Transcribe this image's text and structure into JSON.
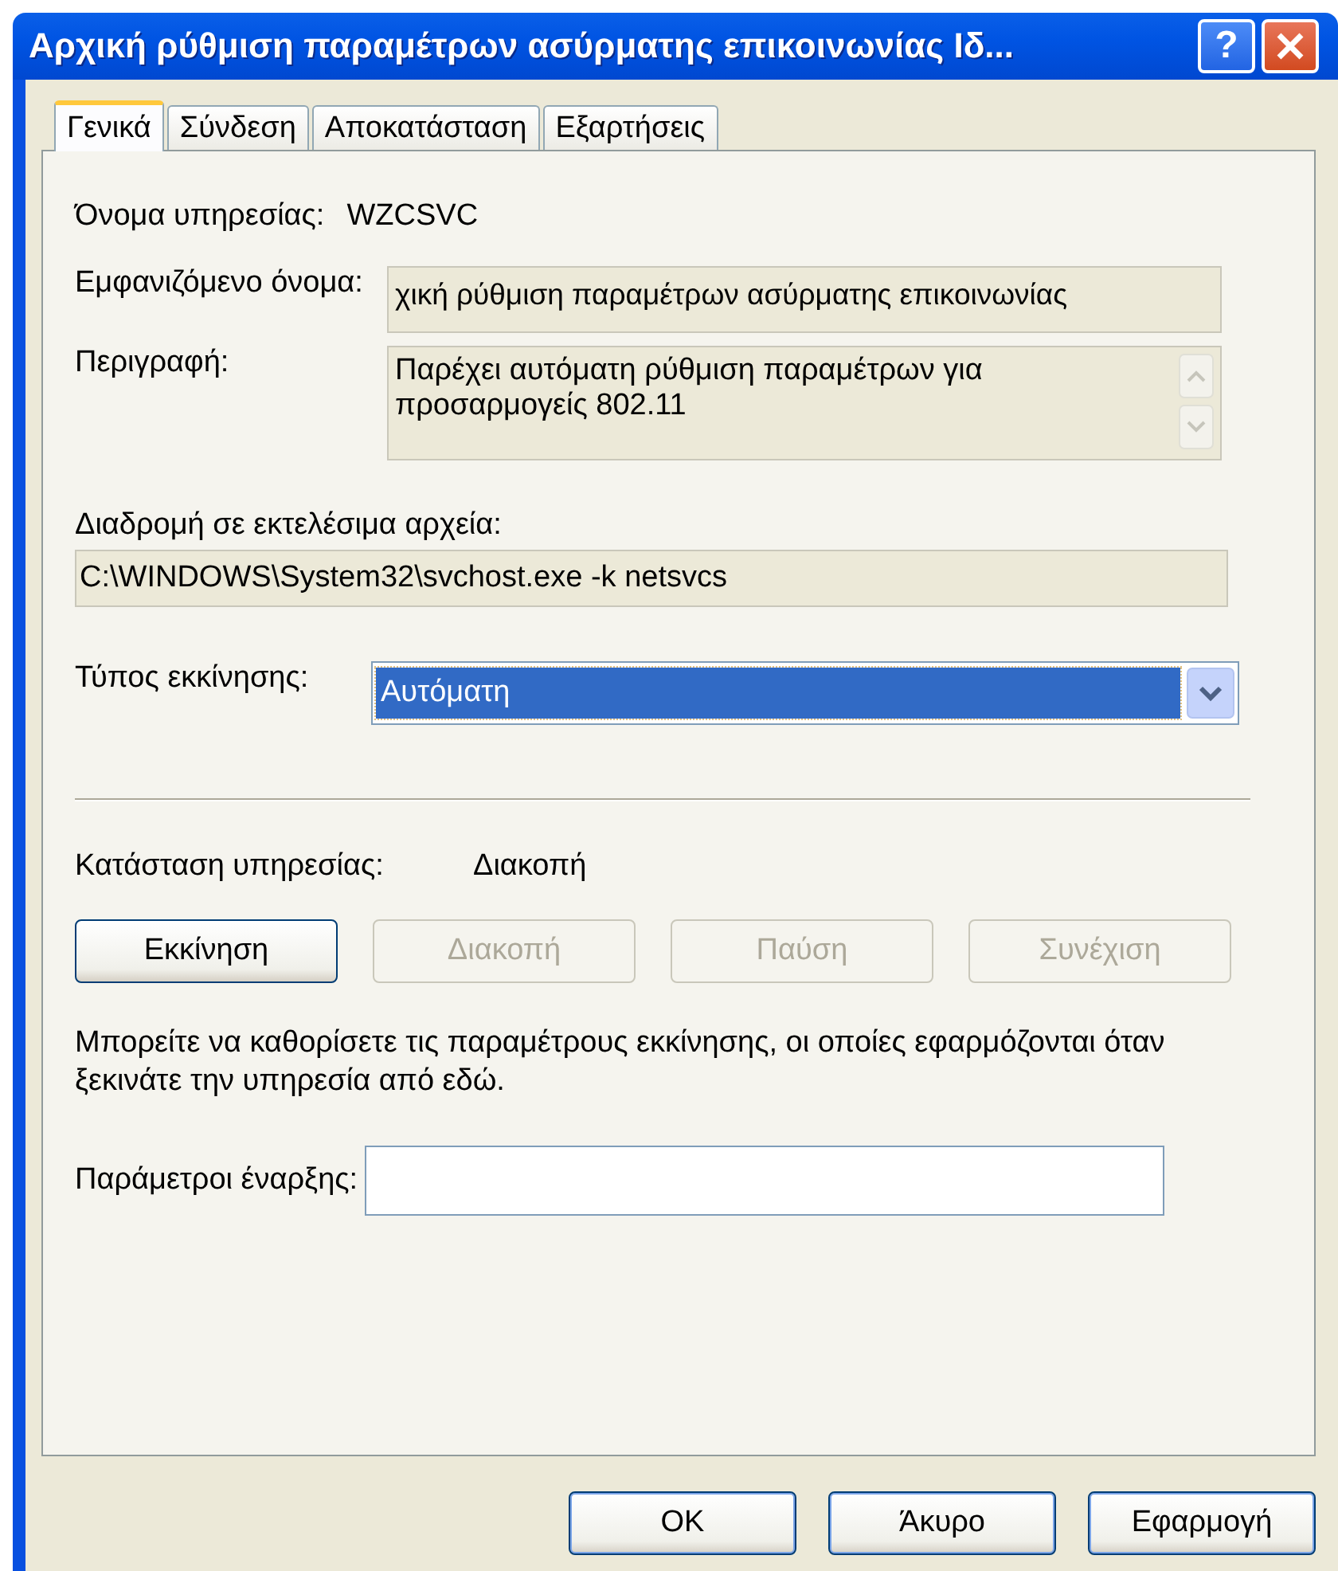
{
  "window": {
    "title": "Αρχική ρύθμιση παραμέτρων ασύρματης επικοινωνίας Ιδ...",
    "help": "?"
  },
  "tabs": [
    {
      "label": "Γενικά",
      "selected": true
    },
    {
      "label": "Σύνδεση",
      "selected": false
    },
    {
      "label": "Αποκατάσταση",
      "selected": false
    },
    {
      "label": "Εξαρτήσεις",
      "selected": false
    }
  ],
  "service_name": {
    "label": "Όνομα υπηρεσίας:",
    "value": "WZCSVC"
  },
  "display_name": {
    "label": "Εμφανιζόμενο όνομα:",
    "value": "χική ρύθμιση παραμέτρων ασύρματης επικοινωνίας"
  },
  "description": {
    "label": "Περιγραφή:",
    "value": "Παρέχει αυτόματη ρύθμιση παραμέτρων για προσαρμογείς 802.11"
  },
  "path": {
    "label": "Διαδρομή σε εκτελέσιμα αρχεία:",
    "value": "C:\\WINDOWS\\System32\\svchost.exe -k netsvcs"
  },
  "startup_type": {
    "label": "Τύπος εκκίνησης:",
    "value": "Αυτόματη"
  },
  "service_status": {
    "label": "Κατάσταση υπηρεσίας:",
    "value": "Διακοπή"
  },
  "service_buttons": [
    {
      "label": "Εκκίνηση",
      "disabled": false
    },
    {
      "label": "Διακοπή",
      "disabled": true
    },
    {
      "label": "Παύση",
      "disabled": true
    },
    {
      "label": "Συνέχιση",
      "disabled": true
    }
  ],
  "note": "Μπορείτε να καθορίσετε τις παραμέτρους εκκίνησης, οι οποίες εφαρμόζονται όταν ξεκινάτε την υπηρεσία από εδώ.",
  "start_parameters": {
    "label": "Παράμετροι έναρξης:"
  },
  "dialog_buttons": [
    {
      "label": "OK"
    },
    {
      "label": "Άκυρο"
    },
    {
      "label": "Εφαρμογή"
    }
  ]
}
